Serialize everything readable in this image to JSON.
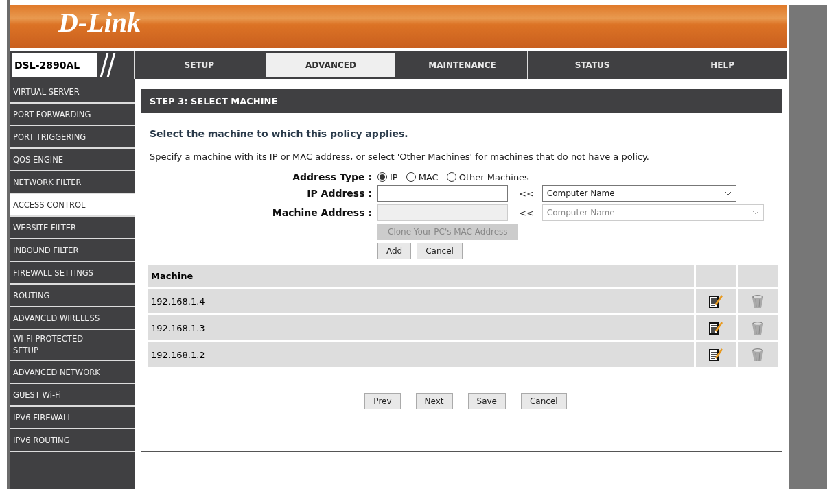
{
  "logo": "D-Link",
  "model": "DSL-2890AL",
  "nav": [
    {
      "label": "SETUP",
      "selected": false
    },
    {
      "label": "ADVANCED",
      "selected": true
    },
    {
      "label": "MAINTENANCE",
      "selected": false
    },
    {
      "label": "STATUS",
      "selected": false
    },
    {
      "label": "HELP",
      "selected": false
    }
  ],
  "sidebar": {
    "items": [
      {
        "label": "VIRTUAL SERVER",
        "selected": false
      },
      {
        "label": "PORT FORWARDING",
        "selected": false
      },
      {
        "label": "PORT TRIGGERING",
        "selected": false
      },
      {
        "label": "QOS ENGINE",
        "selected": false
      },
      {
        "label": "NETWORK FILTER",
        "selected": false
      },
      {
        "label": "ACCESS CONTROL",
        "selected": true
      },
      {
        "label": "WEBSITE FILTER",
        "selected": false
      },
      {
        "label": "INBOUND FILTER",
        "selected": false
      },
      {
        "label": "FIREWALL SETTINGS",
        "selected": false
      },
      {
        "label": "ROUTING",
        "selected": false
      },
      {
        "label": "ADVANCED WIRELESS",
        "selected": false
      },
      {
        "label": "WI-FI PROTECTED SETUP",
        "selected": false
      },
      {
        "label": "ADVANCED NETWORK",
        "selected": false
      },
      {
        "label": "GUEST Wi-Fi",
        "selected": false
      },
      {
        "label": "IPV6 FIREWALL",
        "selected": false
      },
      {
        "label": "IPV6 ROUTING",
        "selected": false
      }
    ]
  },
  "panel": {
    "title": "STEP 3: SELECT MACHINE",
    "heading": "Select the machine to which this policy applies.",
    "description": "Specify a machine with its IP or MAC address, or select 'Other Machines' for machines that do not have a policy.",
    "address_type": {
      "label": "Address Type :",
      "options": [
        {
          "label": "IP",
          "selected": true
        },
        {
          "label": "MAC",
          "selected": false
        },
        {
          "label": "Other Machines",
          "selected": false
        }
      ]
    },
    "fields": [
      {
        "label": "IP Address :",
        "disabled": false,
        "arrow": "<<",
        "select": "Computer Name"
      },
      {
        "label": "Machine Address :",
        "disabled": true,
        "arrow": "<<",
        "select": "Computer Name"
      }
    ],
    "clone_button": {
      "label": "Clone Your PC's MAC Address",
      "disabled": true
    },
    "form_buttons": [
      "Add",
      "Cancel"
    ],
    "table": {
      "columns": [
        "Machine"
      ],
      "rows": [
        {
          "machine": "192.168.1.4"
        },
        {
          "machine": "192.168.1.3"
        },
        {
          "machine": "192.168.1.2"
        }
      ]
    },
    "buttons": [
      "Prev",
      "Next",
      "Save",
      "Cancel"
    ]
  }
}
